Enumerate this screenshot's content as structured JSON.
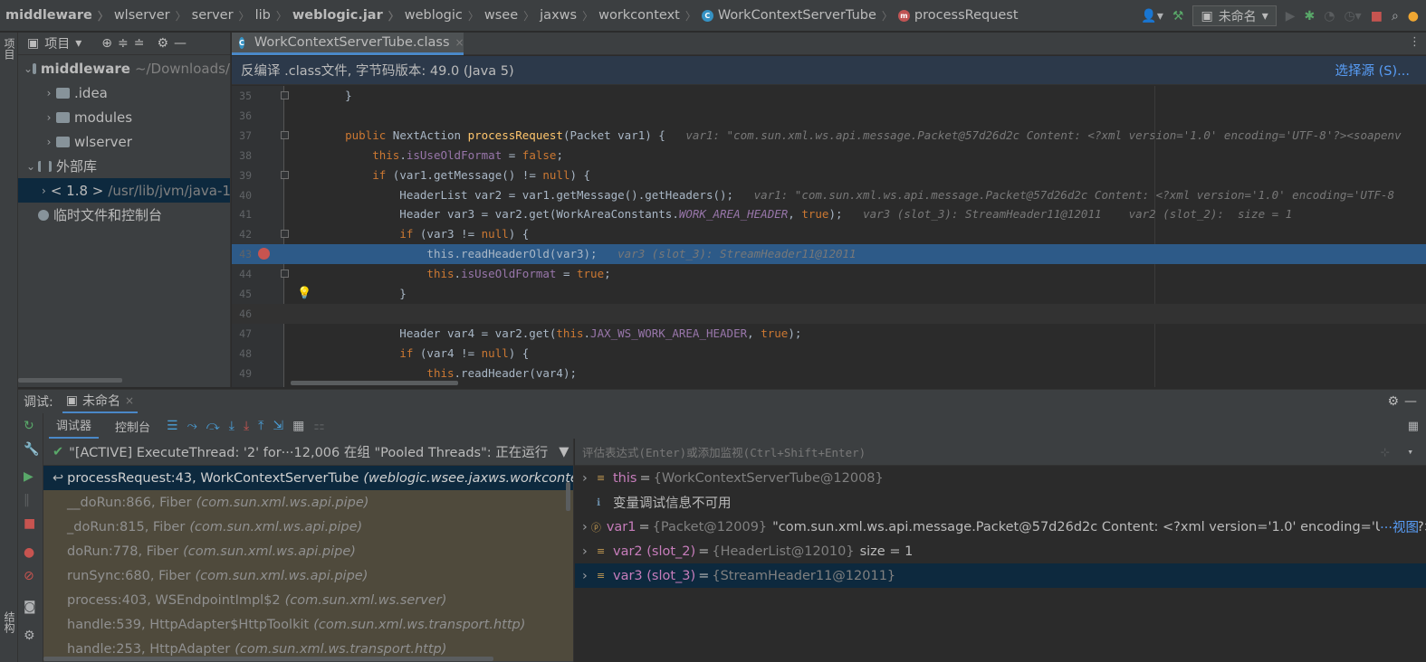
{
  "breadcrumb": [
    {
      "label": "middleware",
      "bold": true
    },
    {
      "label": "wlserver"
    },
    {
      "label": "server"
    },
    {
      "label": "lib"
    },
    {
      "label": "weblogic.jar",
      "bold": true
    },
    {
      "label": "weblogic"
    },
    {
      "label": "wsee"
    },
    {
      "label": "jaxws"
    },
    {
      "label": "workcontext"
    },
    {
      "label": "WorkContextServerTube",
      "icon": "c"
    },
    {
      "label": "processRequest",
      "icon": "m"
    }
  ],
  "toolbar": {
    "run_config": "未命名"
  },
  "side": {
    "project_label": "项目",
    "structure_label": "结构",
    "bookmarks_label": "书签"
  },
  "project": {
    "header": "项目",
    "tree": [
      {
        "label": "middleware",
        "suffix": "~/Downloads/",
        "bold": true,
        "expanded": true,
        "indent": 0
      },
      {
        "label": ".idea",
        "indent": 1
      },
      {
        "label": "modules",
        "indent": 1
      },
      {
        "label": "wlserver",
        "indent": 1
      },
      {
        "label": "外部库",
        "expanded": true,
        "indent": 0,
        "kind": "lib"
      },
      {
        "label": "< 1.8 >",
        "suffix": "/usr/lib/jvm/java-1",
        "indent": 1,
        "selected": true,
        "kind": "jdk"
      },
      {
        "label": "临时文件和控制台",
        "indent": 0,
        "kind": "scratch"
      }
    ]
  },
  "editor": {
    "tab": "WorkContextServerTube.class",
    "banner": "反编译 .class文件, 字节码版本: 49.0 (Java 5)",
    "banner_link": "选择源 (S)...",
    "lines": [
      {
        "n": "35",
        "html": "    }"
      },
      {
        "n": "36",
        "html": ""
      },
      {
        "n": "37",
        "html": "    <span class=\"kw\">public</span> NextAction <span class=\"fn\">processRequest</span>(Packet var1) {   <span class=\"hint\">var1: \"com.sun.xml.ws.api.message.Packet@57d26d2c Content: &lt;?xml version='1.0' encoding='UTF-8'?&gt;&lt;soapenv</span>"
      },
      {
        "n": "38",
        "html": "        <span class=\"kw\">this</span>.<span class=\"fld\">isUseOldFormat</span> = <span class=\"kw\">false</span>;"
      },
      {
        "n": "39",
        "html": "        <span class=\"kw\">if</span> (var1.getMessage() != <span class=\"kw\">null</span>) {"
      },
      {
        "n": "40",
        "html": "            HeaderList var2 = var1.getMessage().getHeaders();   <span class=\"hint\">var1: \"com.sun.xml.ws.api.message.Packet@57d26d2c Content: &lt;?xml version='1.0' encoding='UTF-8</span>"
      },
      {
        "n": "41",
        "html": "            Header var3 = var2.get(WorkAreaConstants.<span class=\"st\">WORK_AREA_HEADER</span>, <span class=\"kw\">true</span>);   <span class=\"hint\">var3 (slot_3): StreamHeader11@12011    var2 (slot_2):  size = 1</span>"
      },
      {
        "n": "42",
        "html": "            <span class=\"kw\">if</span> (var3 != <span class=\"kw\">null</span>) {"
      },
      {
        "n": "43",
        "html": "                <span class=\"kw\">this</span>.readHeaderOld(var3);   <span class=\"hint\">var3 (slot_3): StreamHeader11@12011</span>",
        "highlight": true,
        "breakpoint": true
      },
      {
        "n": "44",
        "html": "                <span class=\"kw\">this</span>.<span class=\"fld\">isUseOldFormat</span> = <span class=\"kw\">true</span>;"
      },
      {
        "n": "45",
        "html": "            }",
        "bulb": true
      },
      {
        "n": "46",
        "html": "",
        "current": true
      },
      {
        "n": "47",
        "html": "            Header var4 = var2.get(<span class=\"kw\">this</span>.<span class=\"fld\">JAX_WS_WORK_AREA_HEADER</span>, <span class=\"kw\">true</span>);"
      },
      {
        "n": "48",
        "html": "            <span class=\"kw\">if</span> (var4 != <span class=\"kw\">null</span>) {"
      },
      {
        "n": "49",
        "html": "                <span class=\"kw\">this</span>.readHeader(var4);"
      }
    ]
  },
  "debug": {
    "title": "调试:",
    "session_tab": "未命名",
    "tabs": [
      "调试器",
      "控制台"
    ],
    "thread": "\"[ACTIVE] ExecuteThread: '2' for···12,006 在组 \"Pooled Threads\": 正在运行",
    "eval_placeholder": "评估表达式(Enter)或添加监视(Ctrl+Shift+Enter)",
    "frames": [
      {
        "method": "processRequest:43, WorkContextServerTube",
        "pkg": "(weblogic.wsee.jaxws.workcontext)",
        "selected": true
      },
      {
        "method": "__doRun:866, Fiber",
        "pkg": "(com.sun.xml.ws.api.pipe)"
      },
      {
        "method": "_doRun:815, Fiber",
        "pkg": "(com.sun.xml.ws.api.pipe)"
      },
      {
        "method": "doRun:778, Fiber",
        "pkg": "(com.sun.xml.ws.api.pipe)"
      },
      {
        "method": "runSync:680, Fiber",
        "pkg": "(com.sun.xml.ws.api.pipe)"
      },
      {
        "method": "process:403, WSEndpointImpl$2",
        "pkg": "(com.sun.xml.ws.server)"
      },
      {
        "method": "handle:539, HttpAdapter$HttpToolkit",
        "pkg": "(com.sun.xml.ws.transport.http)"
      },
      {
        "method": "handle:253, HttpAdapter",
        "pkg": "(com.sun.xml.ws.transport.http)"
      }
    ],
    "vars": [
      {
        "name": "this",
        "ref": "{WorkContextServerTube@12008}",
        "expandable": true,
        "icon": "field"
      },
      {
        "name": "",
        "note": "变量调试信息不可用",
        "expandable": false,
        "icon": "info"
      },
      {
        "name": "var1",
        "ref": "{Packet@12009}",
        "value": "\"com.sun.xml.ws.api.message.Packet@57d26d2c Content: <?xml version='1.0' encoding='UTF-8'?><s",
        "link": "···视图",
        "expandable": true,
        "icon": "param"
      },
      {
        "name": "var2 (slot_2)",
        "ref": "{HeaderList@12010}",
        "value": "size = 1",
        "expandable": true,
        "icon": "field"
      },
      {
        "name": "var3 (slot_3)",
        "ref": "{StreamHeader11@12011}",
        "expandable": true,
        "icon": "field",
        "selected": true
      }
    ]
  }
}
